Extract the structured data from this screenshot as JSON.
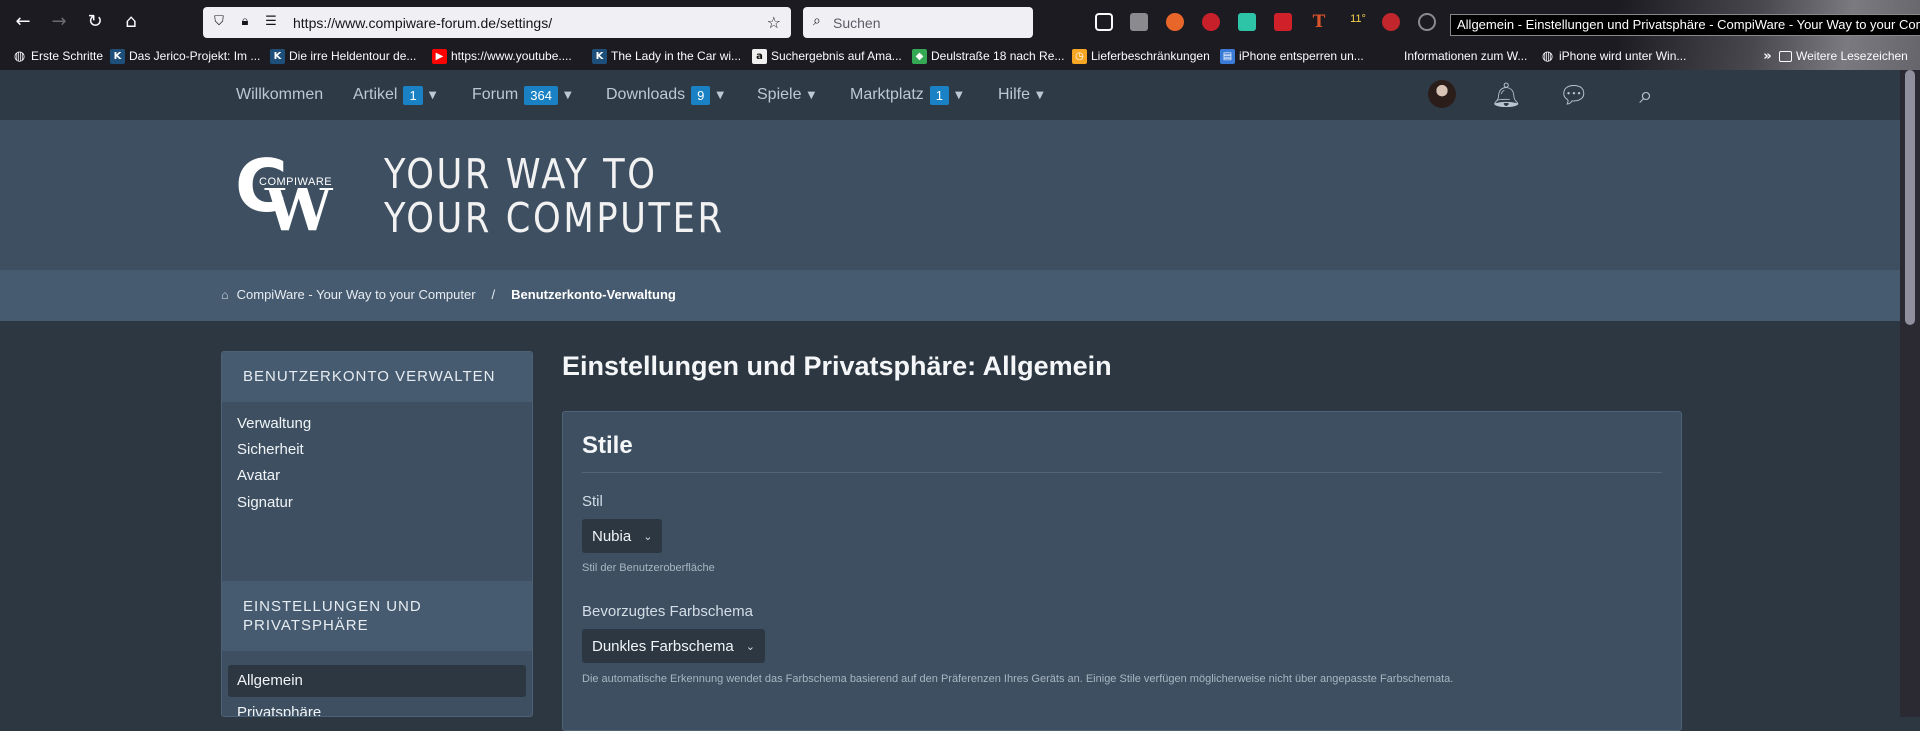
{
  "browser": {
    "url": "https://www.compiware-forum.de/settings/",
    "search_placeholder": "Suchen",
    "window_title": "Allgemein - Einstellungen und Privatsphäre - CompiWare - Your Way to your Computer",
    "weather_temp": "11°",
    "bookmarks": [
      {
        "label": "Erste Schritte",
        "icon": "globe-icon",
        "color": "#fbfbfe"
      },
      {
        "label": "Das Jerico-Projekt: Im ...",
        "icon": "k-site-icon",
        "color": "#1d4f7a"
      },
      {
        "label": "Die irre Heldentour de...",
        "icon": "k-site-icon",
        "color": "#1d4f7a"
      },
      {
        "label": "https://www.youtube....",
        "icon": "youtube-icon",
        "color": "#ff0000"
      },
      {
        "label": "The Lady in the Car wi...",
        "icon": "k-site-icon",
        "color": "#1d4f7a"
      },
      {
        "label": "Suchergebnis auf Ama...",
        "icon": "amazon-icon",
        "color": "#f0f0f0"
      },
      {
        "label": "Deulstraße 18 nach Re...",
        "icon": "maps-icon",
        "color": "#34a853"
      },
      {
        "label": "Lieferbeschränkungen",
        "icon": "clock-icon",
        "color": "#f5a623"
      },
      {
        "label": "iPhone entsperren un...",
        "icon": "article-icon",
        "color": "#3b7bd8"
      },
      {
        "label": "Informationen zum W...",
        "icon": "apple-icon",
        "color": "#1c1b22"
      },
      {
        "label": "iPhone wird unter Win...",
        "icon": "globe-icon",
        "color": "#fbfbfe"
      }
    ],
    "more_bookmarks": "Weitere Lesezeichen"
  },
  "forum_nav": {
    "items": [
      {
        "label": "Willkommen",
        "badge": null,
        "dropdown": false
      },
      {
        "label": "Artikel",
        "badge": "1",
        "dropdown": true
      },
      {
        "label": "Forum",
        "badge": "364",
        "dropdown": true
      },
      {
        "label": "Downloads",
        "badge": "9",
        "dropdown": true
      },
      {
        "label": "Spiele",
        "badge": null,
        "dropdown": true
      },
      {
        "label": "Marktplatz",
        "badge": "1",
        "dropdown": true
      },
      {
        "label": "Hilfe",
        "badge": null,
        "dropdown": true
      }
    ]
  },
  "banner": {
    "logo_word": "COMPIWARE",
    "tagline_line1": "YOUR WAY TO",
    "tagline_line2": "YOUR COMPUTER"
  },
  "breadcrumb": {
    "home": "CompiWare - Your Way to your Computer",
    "separator": "/",
    "current": "Benutzerkonto-Verwaltung"
  },
  "sidebar": {
    "section1_title": "BENUTZERKONTO VERWALTEN",
    "section1_items": [
      "Verwaltung",
      "Sicherheit",
      "Avatar",
      "Signatur"
    ],
    "section2_title_line1": "EINSTELLUNGEN UND",
    "section2_title_line2": "PRIVATSPHÄRE",
    "section2_items": [
      "Allgemein",
      "Privatsphäre"
    ]
  },
  "main": {
    "page_title": "Einstellungen und Privatsphäre: Allgemein",
    "panel_title": "Stile",
    "style_label": "Stil",
    "style_value": "Nubia",
    "style_hint": "Stil der Benutzeroberfläche",
    "scheme_label": "Bevorzugtes Farbschema",
    "scheme_value": "Dunkles Farbschema",
    "scheme_hint": "Die automatische Erkennung wendet das Farbschema basierend auf den Präferenzen Ihres Geräts an. Einige Stile verfügen möglicherweise nicht über angepasste Farbschemata."
  },
  "colors": {
    "accent": "#1a82c4",
    "page_bg": "#2c3742",
    "panel_bg": "#3d4f61",
    "breadcrumb_bg": "#475b70"
  }
}
